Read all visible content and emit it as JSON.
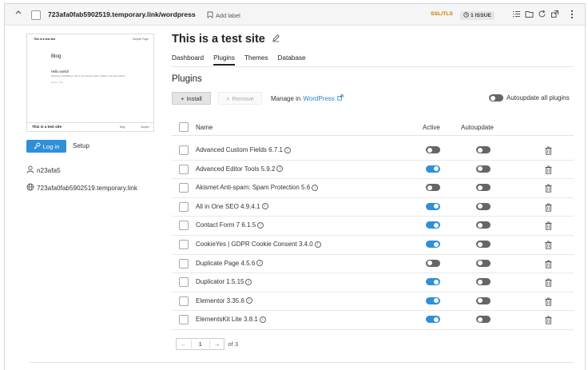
{
  "header": {
    "domain": "723afa0fab5902519.temporary.link/wordpress",
    "add_label": "Add label",
    "ssl": "SSL/TLS",
    "issues": "1 ISSUE"
  },
  "preview": {
    "site_name": "This is a test site",
    "nav": "Sample Page",
    "blog": "Blog",
    "post_title": "Hello world!",
    "post_text": "Welcome to WordPress. This is your first post. Edit or delete it, then start writing!",
    "post_meta": "March 2, 2024",
    "footer_title": "This is a test site",
    "footer_blog": "Blog",
    "footer_link": "Sample"
  },
  "sidebar": {
    "login_label": "Log in",
    "setup_label": "Setup",
    "username": "n23afa5",
    "site_url": "723afa0fab5902519.temporary.link"
  },
  "main": {
    "title": "This is a test site",
    "tabs": [
      {
        "label": "Dashboard",
        "active": false
      },
      {
        "label": "Plugins",
        "active": true
      },
      {
        "label": "Themes",
        "active": false
      },
      {
        "label": "Database",
        "active": false
      }
    ],
    "section_title": "Plugins",
    "install_label": "Install",
    "remove_label": "Remove",
    "manage_prefix": "Manage in",
    "manage_link": "WordPress",
    "autoupdate_all": "Autoupdate all plugins"
  },
  "table": {
    "columns": {
      "name": "Name",
      "active": "Active",
      "autoupdate": "Autoupdate"
    },
    "rows": [
      {
        "name": "Advanced Custom Fields 6.7.1",
        "active": false,
        "autoupdate": false
      },
      {
        "name": "Advanced Editor Tools 5.9.2",
        "active": true,
        "autoupdate": false
      },
      {
        "name": "Akismet Anti-spam: Spam Protection 5.6",
        "active": false,
        "autoupdate": false
      },
      {
        "name": "All in One SEO 4.9.4.1",
        "active": true,
        "autoupdate": false
      },
      {
        "name": "Contact Form 7 6.1.5",
        "active": true,
        "autoupdate": false
      },
      {
        "name": "CookieYes | GDPR Cookie Consent 3.4.0",
        "active": true,
        "autoupdate": false
      },
      {
        "name": "Duplicate Page 4.5.6",
        "active": false,
        "autoupdate": false
      },
      {
        "name": "Duplicator 1.5.15",
        "active": true,
        "autoupdate": false
      },
      {
        "name": "Elementor 3.35.6",
        "active": true,
        "autoupdate": false
      },
      {
        "name": "ElementsKit Lite 3.8.1",
        "active": true,
        "autoupdate": false
      }
    ]
  },
  "pagination": {
    "page": "1",
    "of_label": "of 3"
  },
  "colors": {
    "accent": "#2f8fd8",
    "toggle_off": "#666666",
    "ssl_warning": "#c47b00"
  }
}
